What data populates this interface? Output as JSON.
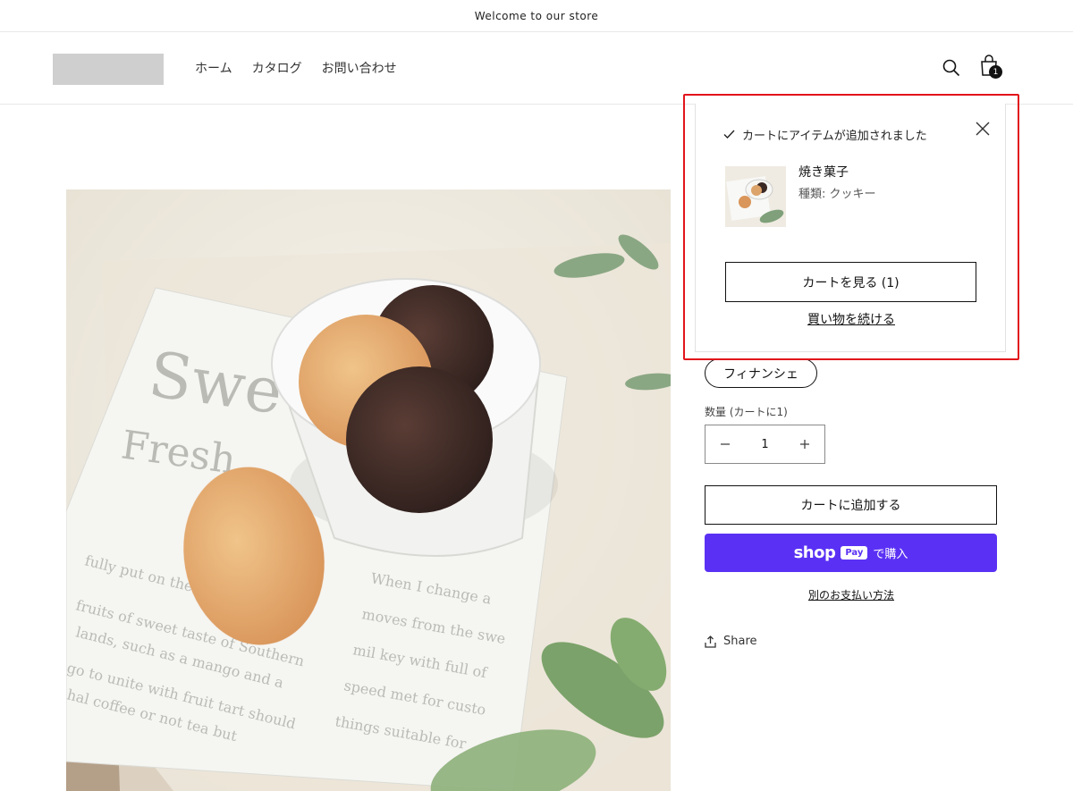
{
  "announcement": {
    "text": "Welcome to our store"
  },
  "header": {
    "nav": [
      "ホーム",
      "カタログ",
      "お問い合わせ"
    ],
    "cart_count": "1"
  },
  "product": {
    "variant_option": "フィナンシェ",
    "quantity_label": "数量 (カートに1)",
    "quantity_value": "1",
    "add_to_cart": "カートに追加する",
    "shop_pay": {
      "shop": "shop",
      "pay": "Pay",
      "buy": "で購入"
    },
    "more_payment": "別のお支払い方法",
    "share": "Share"
  },
  "cart_popup": {
    "message": "カートにアイテムが追加されました",
    "item_title": "焼き菓子",
    "item_variant": "種類: クッキー",
    "view_cart": "カートを見る (1)",
    "continue_shopping": "買い物を続ける"
  },
  "colors": {
    "shop_pay_purple": "#5a31f4",
    "highlight_red": "#e2141c"
  }
}
